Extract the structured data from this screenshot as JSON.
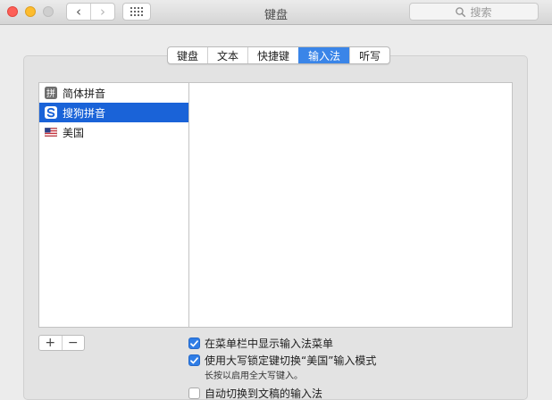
{
  "window": {
    "title": "键盘"
  },
  "toolbar": {
    "back_glyph": "‹",
    "forward_glyph": "›",
    "search_placeholder": "搜索"
  },
  "tabs": [
    {
      "label": "键盘",
      "active": false
    },
    {
      "label": "文本",
      "active": false
    },
    {
      "label": "快捷键",
      "active": false
    },
    {
      "label": "输入法",
      "active": true
    },
    {
      "label": "听写",
      "active": false
    }
  ],
  "input_sources": [
    {
      "label": "简体拼音",
      "icon": "pinyin-icon",
      "selected": false
    },
    {
      "label": "搜狗拼音",
      "icon": "sogou-icon",
      "selected": true
    },
    {
      "label": "美国",
      "icon": "us-flag-icon",
      "selected": false
    }
  ],
  "list_controls": {
    "add": "+",
    "remove": "−"
  },
  "options": [
    {
      "label": "在菜单栏中显示输入法菜单",
      "checked": true
    },
    {
      "label": "使用大写锁定键切换“美国”输入模式",
      "checked": true
    },
    {
      "label": "自动切换到文稿的输入法",
      "checked": false
    }
  ],
  "options_note": "长按以启用全大写键入。",
  "colors": {
    "accent": "#3a85e8",
    "selection": "#1a63d8",
    "close": "#fd5f57",
    "minimize": "#fdbc2e",
    "zoom_inactive": "#cfcfcf"
  }
}
